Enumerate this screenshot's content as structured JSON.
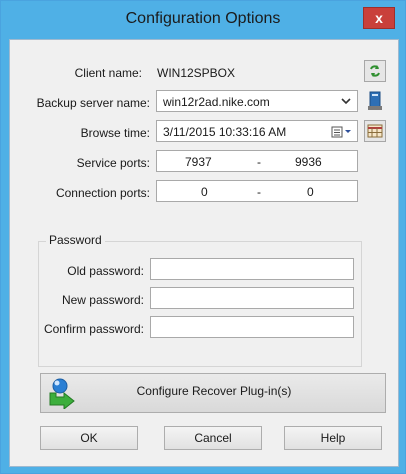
{
  "window": {
    "title": "Configuration Options",
    "close_glyph": "x"
  },
  "client_name": {
    "label": "Client name:",
    "value": "WIN12SPBOX"
  },
  "backup_server": {
    "label": "Backup server name:",
    "value": "win12r2ad.nike.com"
  },
  "browse_time": {
    "label": "Browse time:",
    "value": "3/11/2015 10:33:16 AM"
  },
  "service_ports": {
    "label": "Service ports:",
    "from": "7937",
    "sep": "-",
    "to": "9936"
  },
  "connection_ports": {
    "label": "Connection ports:",
    "from": "0",
    "sep": "-",
    "to": "0"
  },
  "password": {
    "group_title": "Password",
    "old_label": "Old password:",
    "new_label": "New password:",
    "confirm_label": "Confirm password:"
  },
  "configure_button": {
    "label": "Configure Recover Plug-in(s)"
  },
  "buttons": {
    "ok": "OK",
    "cancel": "Cancel",
    "help": "Help"
  },
  "colors": {
    "titlebar": "#4fb0e6",
    "close": "#c9403b",
    "dialog_bg": "#f0f0f0"
  },
  "icons": [
    "refresh-icon",
    "chevron-down-icon",
    "server-book-icon",
    "calendar-icon",
    "grid-calendar-icon",
    "recover-plugin-icon",
    "close-icon"
  ]
}
